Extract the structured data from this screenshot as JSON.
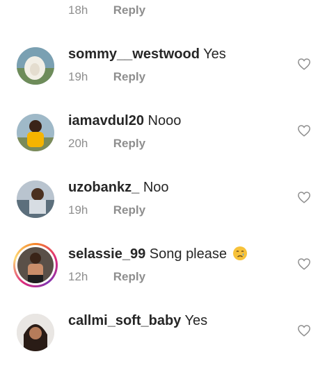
{
  "comments": [
    {
      "username": "",
      "message": "",
      "time": "18h",
      "reply": "Reply"
    },
    {
      "username": "sommy__westwood",
      "message": "Yes",
      "time": "19h",
      "reply": "Reply"
    },
    {
      "username": "iamavdul20",
      "message": "Nooo",
      "time": "20h",
      "reply": "Reply"
    },
    {
      "username": "uzobankz_",
      "message": "Noo",
      "time": "19h",
      "reply": "Reply"
    },
    {
      "username": "selassie_99",
      "message": "Song please",
      "emoji": "crying-face-emoji",
      "time": "12h",
      "reply": "Reply",
      "story_ring": true
    },
    {
      "username": "callmi_soft_baby",
      "message": "Yes",
      "time": "",
      "reply": ""
    }
  ],
  "icons": {
    "like": "heart-outline-icon"
  },
  "colors": {
    "text": "#262626",
    "secondary": "#8e8e8e",
    "background": "#ffffff"
  }
}
